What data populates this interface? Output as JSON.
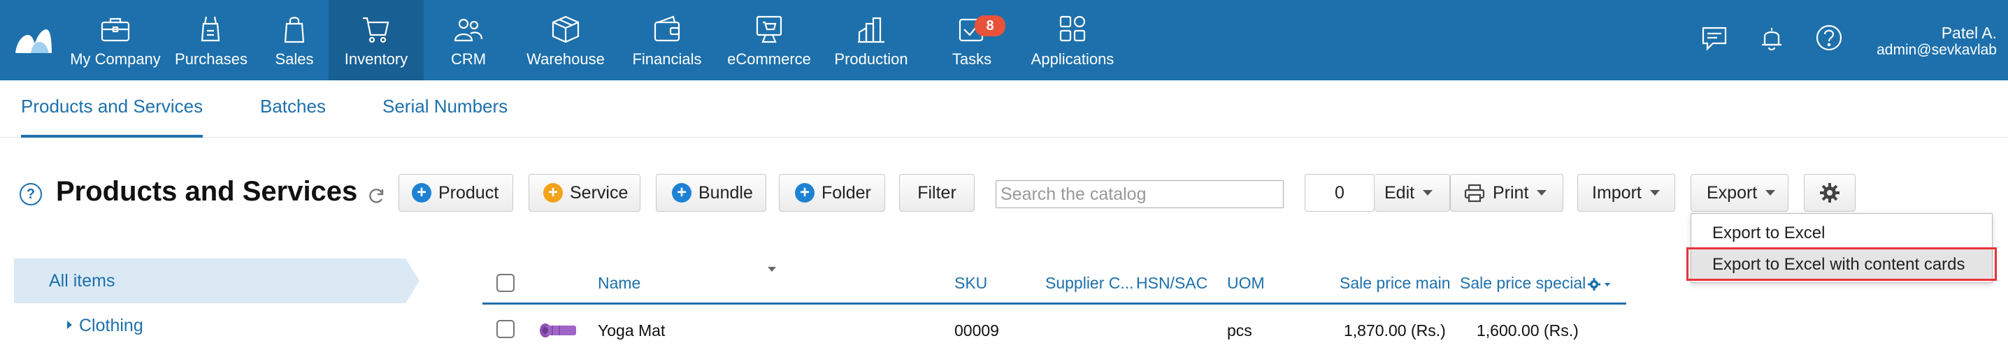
{
  "nav": {
    "items": [
      {
        "label": "My Company",
        "icon": "briefcase-icon",
        "active": false
      },
      {
        "label": "Purchases",
        "icon": "shopping-bag-icon",
        "active": false
      },
      {
        "label": "Sales",
        "icon": "bag-icon",
        "active": false
      },
      {
        "label": "Inventory",
        "icon": "cart-icon",
        "active": true
      },
      {
        "label": "CRM",
        "icon": "people-icon",
        "active": false
      },
      {
        "label": "Warehouse",
        "icon": "box-icon",
        "active": false
      },
      {
        "label": "Financials",
        "icon": "wallet-icon",
        "active": false
      },
      {
        "label": "eCommerce",
        "icon": "storefront-icon",
        "active": false
      },
      {
        "label": "Production",
        "icon": "factory-icon",
        "active": false
      },
      {
        "label": "Tasks",
        "icon": "checkbox-icon",
        "active": false,
        "badge": "8"
      },
      {
        "label": "Applications",
        "icon": "grid-icon",
        "active": false
      }
    ],
    "user_name": "Patel A.",
    "user_email": "admin@sevkavlab",
    "colors": {
      "bar": "#1d70ab",
      "active": "#185f93",
      "badge": "#e8523b"
    }
  },
  "subtabs": [
    {
      "label": "Products and Services",
      "active": true
    },
    {
      "label": "Batches",
      "active": false
    },
    {
      "label": "Serial Numbers",
      "active": false
    }
  ],
  "toolbar": {
    "help": "?",
    "title": "Products and Services",
    "product": "Product",
    "service": "Service",
    "bundle": "Bundle",
    "folder": "Folder",
    "filter": "Filter",
    "search_placeholder": "Search the catalog",
    "count": "0",
    "edit": "Edit",
    "print": "Print",
    "import": "Import",
    "export": "Export"
  },
  "export_menu": {
    "items": [
      "Export to Excel",
      "Export to Excel with content cards"
    ],
    "hovered_index": 1
  },
  "sidebar": {
    "all_items": "All items",
    "tree": [
      "Clothing"
    ]
  },
  "table": {
    "columns": [
      "Name",
      "SKU",
      "Supplier C...",
      "HSN/SAC",
      "UOM",
      "Sale price main",
      "Sale price special"
    ],
    "rows": [
      {
        "name": "Yoga Mat",
        "sku": "00009",
        "supplier": "",
        "hsn": "",
        "uom": "pcs",
        "price_main": "1,870.00 (Rs.)",
        "price_special": "1,600.00 (Rs.)"
      }
    ]
  }
}
